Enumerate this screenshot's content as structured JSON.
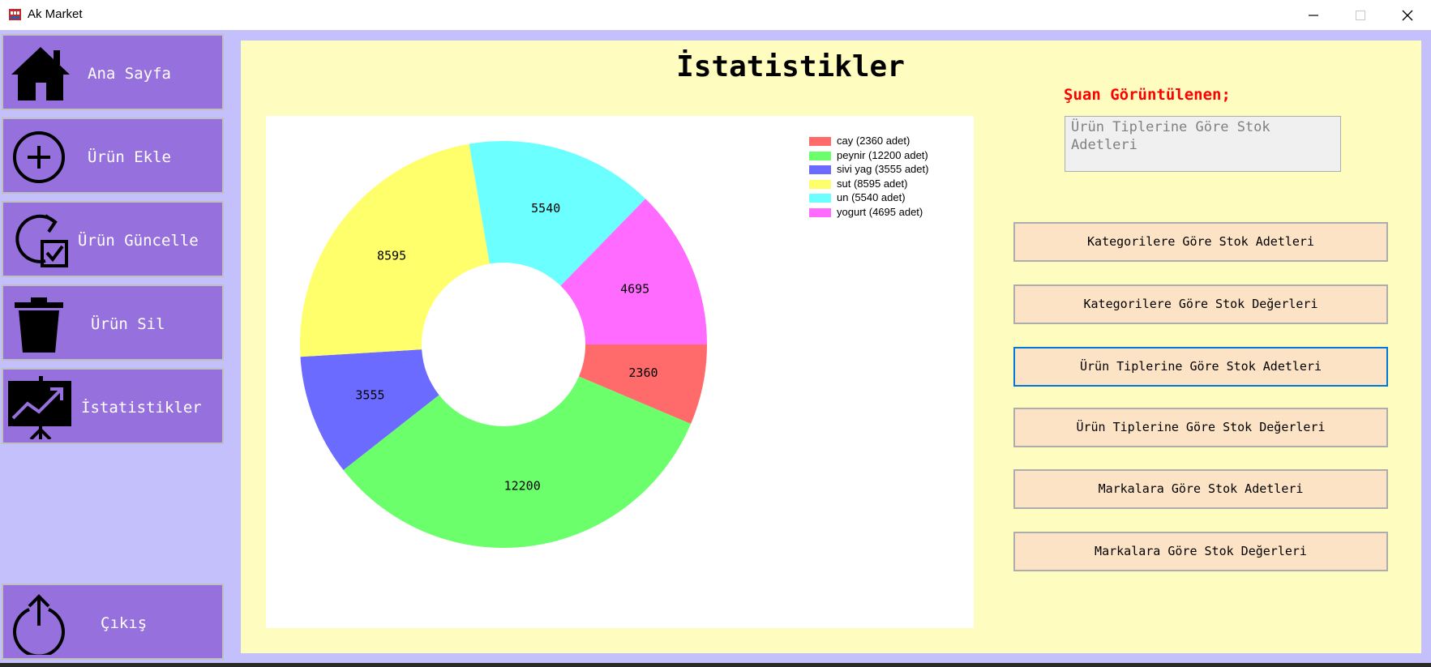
{
  "window": {
    "title": "Ak Market",
    "accent": "#9670dc",
    "panel_bg": "#fffcc0"
  },
  "sidebar": {
    "items": [
      {
        "label": "Ana Sayfa",
        "icon": "home-icon"
      },
      {
        "label": "Ürün Ekle",
        "icon": "plus-circle-icon"
      },
      {
        "label": "Ürün Güncelle",
        "icon": "update-check-icon"
      },
      {
        "label": "Ürün Sil",
        "icon": "trash-icon"
      },
      {
        "label": "İstatistikler",
        "icon": "presentation-chart-icon"
      }
    ],
    "exit": {
      "label": "Çıkış",
      "icon": "power-icon"
    }
  },
  "main": {
    "title": "İstatistikler",
    "current_label": "Şuan Görüntülenen;",
    "current_value": "Ürün Tiplerine Göre Stok Adetleri",
    "buttons": [
      {
        "label": "Kategorilere Göre Stok Adetleri"
      },
      {
        "label": "Kategorilere Göre Stok Değerleri"
      },
      {
        "label": "Ürün Tiplerine Göre Stok Adetleri",
        "active": true
      },
      {
        "label": "Ürün Tiplerine Göre Stok Değerleri"
      },
      {
        "label": "Markalara Göre Stok Adetleri"
      },
      {
        "label": "Markalara Göre Stok Değerleri"
      }
    ]
  },
  "chart_data": {
    "type": "pie",
    "variant": "donut",
    "categories": [
      "cay",
      "peynir",
      "sivi yag",
      "sut",
      "un",
      "yogurt"
    ],
    "values": [
      2360,
      12200,
      3555,
      8595,
      5540,
      4695
    ],
    "colors": [
      "#ff6b6b",
      "#6bff6b",
      "#6b6bff",
      "#ffff6b",
      "#6bffff",
      "#ff6bff"
    ],
    "legend": [
      "cay (2360  adet)",
      "peynir (12200  adet)",
      "sivi yag (3555 adet)",
      "sut (8595  adet)",
      "un (5540  adet)",
      "yogurt (4695  adet)"
    ],
    "legend_position": "top-right"
  }
}
